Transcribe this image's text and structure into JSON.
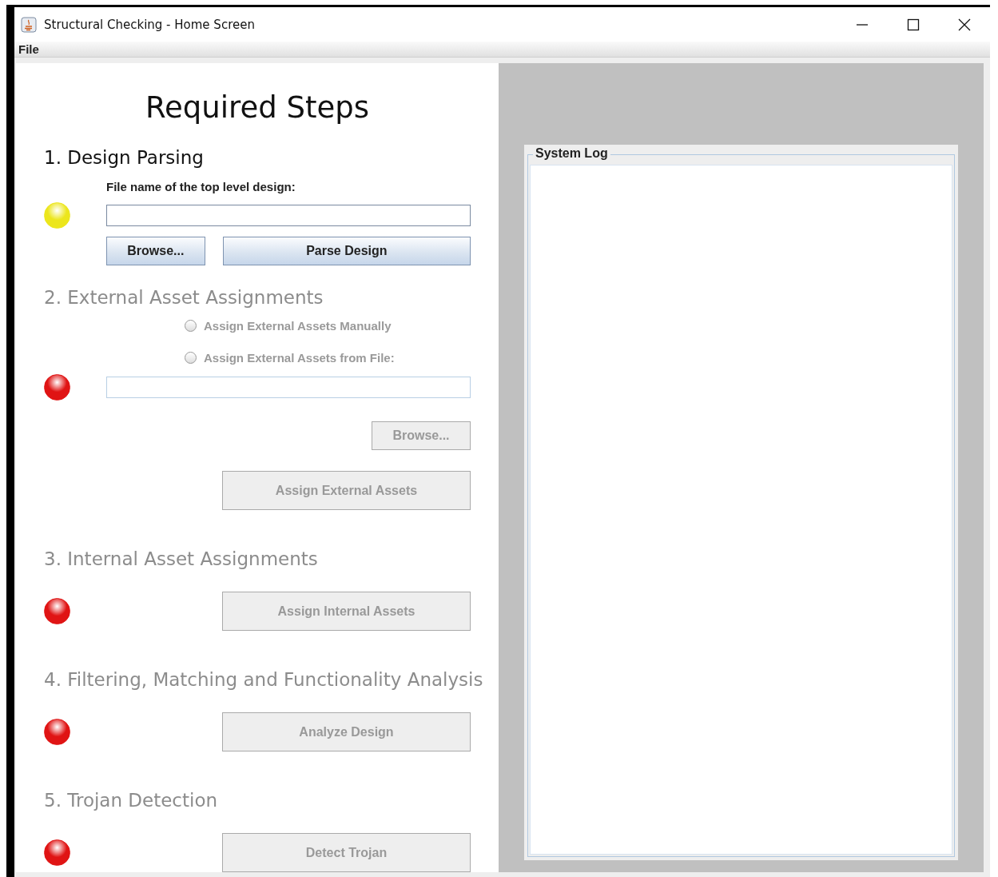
{
  "window": {
    "title": "Structural Checking - Home Screen"
  },
  "menu": [
    "File"
  ],
  "heading": "Required Steps",
  "steps": [
    {
      "title": "1. Design Parsing",
      "disabled": false,
      "status": {
        "color": "#ece61c"
      },
      "items": [
        {
          "kind": "label",
          "text": "File name of the top level design:"
        },
        {
          "kind": "field",
          "value": ""
        },
        {
          "kind": "buttons",
          "buttons": [
            {
              "kind": "browse",
              "label": "Browse..."
            },
            {
              "kind": "action",
              "label": "Parse Design"
            }
          ]
        }
      ]
    },
    {
      "title": "2. External Asset Assignments",
      "disabled": true,
      "status": {
        "color": "#e01414"
      },
      "items": [
        {
          "kind": "radio",
          "label": "Assign External Assets Manually",
          "selected": false
        },
        {
          "kind": "radio",
          "label": "Assign External Assets from File:",
          "selected": false
        },
        {
          "kind": "field",
          "value": ""
        },
        {
          "kind": "buttons",
          "buttons": [
            {
              "kind": "browse",
              "label": "Browse..."
            }
          ]
        },
        {
          "kind": "buttons",
          "buttons": [
            {
              "kind": "action",
              "label": "Assign External Assets"
            }
          ]
        }
      ]
    },
    {
      "title": "3. Internal Asset Assignments",
      "disabled": true,
      "status": {
        "color": "#e01414"
      },
      "items": [
        {
          "kind": "buttons",
          "buttons": [
            {
              "kind": "action",
              "label": "Assign Internal Assets"
            }
          ]
        }
      ]
    },
    {
      "title": "4. Filtering, Matching and Functionality Analysis",
      "disabled": true,
      "status": {
        "color": "#e01414"
      },
      "items": [
        {
          "kind": "buttons",
          "buttons": [
            {
              "kind": "action",
              "label": "Analyze Design"
            }
          ]
        }
      ]
    },
    {
      "title": "5. Trojan Detection",
      "disabled": true,
      "status": {
        "color": "#e01414"
      },
      "items": [
        {
          "kind": "buttons",
          "buttons": [
            {
              "kind": "action",
              "label": "Detect Trojan"
            }
          ]
        }
      ]
    }
  ],
  "system_log": {
    "title": "System Log"
  }
}
